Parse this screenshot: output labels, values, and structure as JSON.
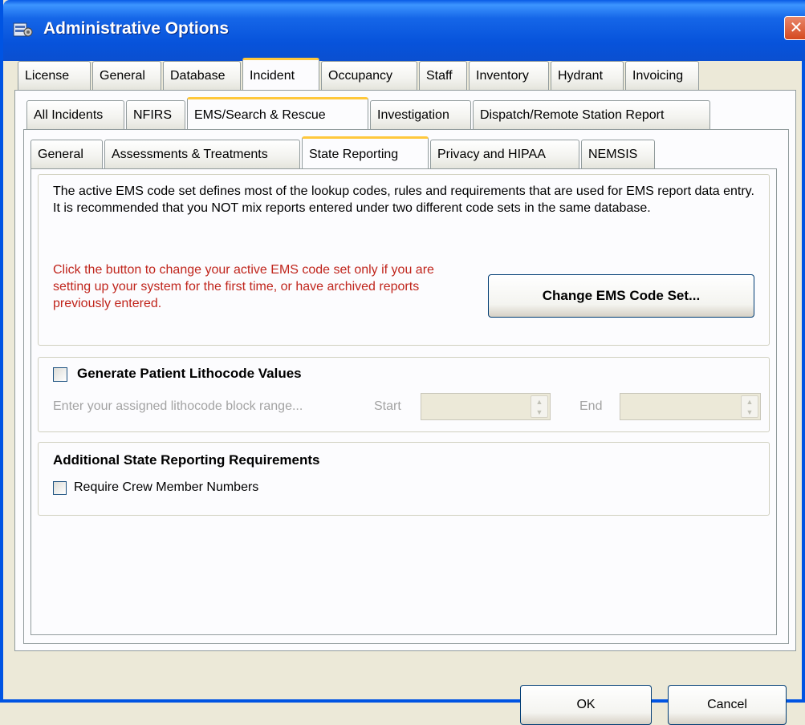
{
  "window": {
    "title": "Administrative Options",
    "close_glyph": "✕",
    "icon": "app-settings-icon"
  },
  "tabs_row1": [
    "License",
    "General",
    "Database",
    "Incident",
    "Occupancy",
    "Staff",
    "Inventory",
    "Hydrant",
    "Invoicing"
  ],
  "tabs_row2": [
    "All Incidents",
    "NFIRS",
    "EMS/Search & Rescue",
    "Investigation",
    "Dispatch/Remote Station Report"
  ],
  "tabs_row3": [
    "General",
    "Assessments & Treatments",
    "State Reporting",
    "Privacy and HIPAA",
    "NEMSIS"
  ],
  "code_set": {
    "description": "The active EMS code set defines most of the lookup codes, rules and requirements that are used for EMS report data entry. It is recommended that you NOT mix reports entered under two different code sets in the same database.",
    "warning": "Click the button to change your active EMS code set only if you are setting up your system for the first time, or have archived reports previously entered.",
    "button_label": "Change EMS Code Set..."
  },
  "lithocode": {
    "checkbox_label": "Generate Patient Lithocode Values",
    "checked": false,
    "hint": "Enter your assigned lithocode block range...",
    "start_label": "Start",
    "start_value": "",
    "end_label": "End",
    "end_value": ""
  },
  "additional": {
    "heading": "Additional State Reporting Requirements",
    "crew_label": "Require Crew Member Numbers",
    "crew_checked": false
  },
  "footer": {
    "ok_label": "OK",
    "cancel_label": "Cancel"
  }
}
